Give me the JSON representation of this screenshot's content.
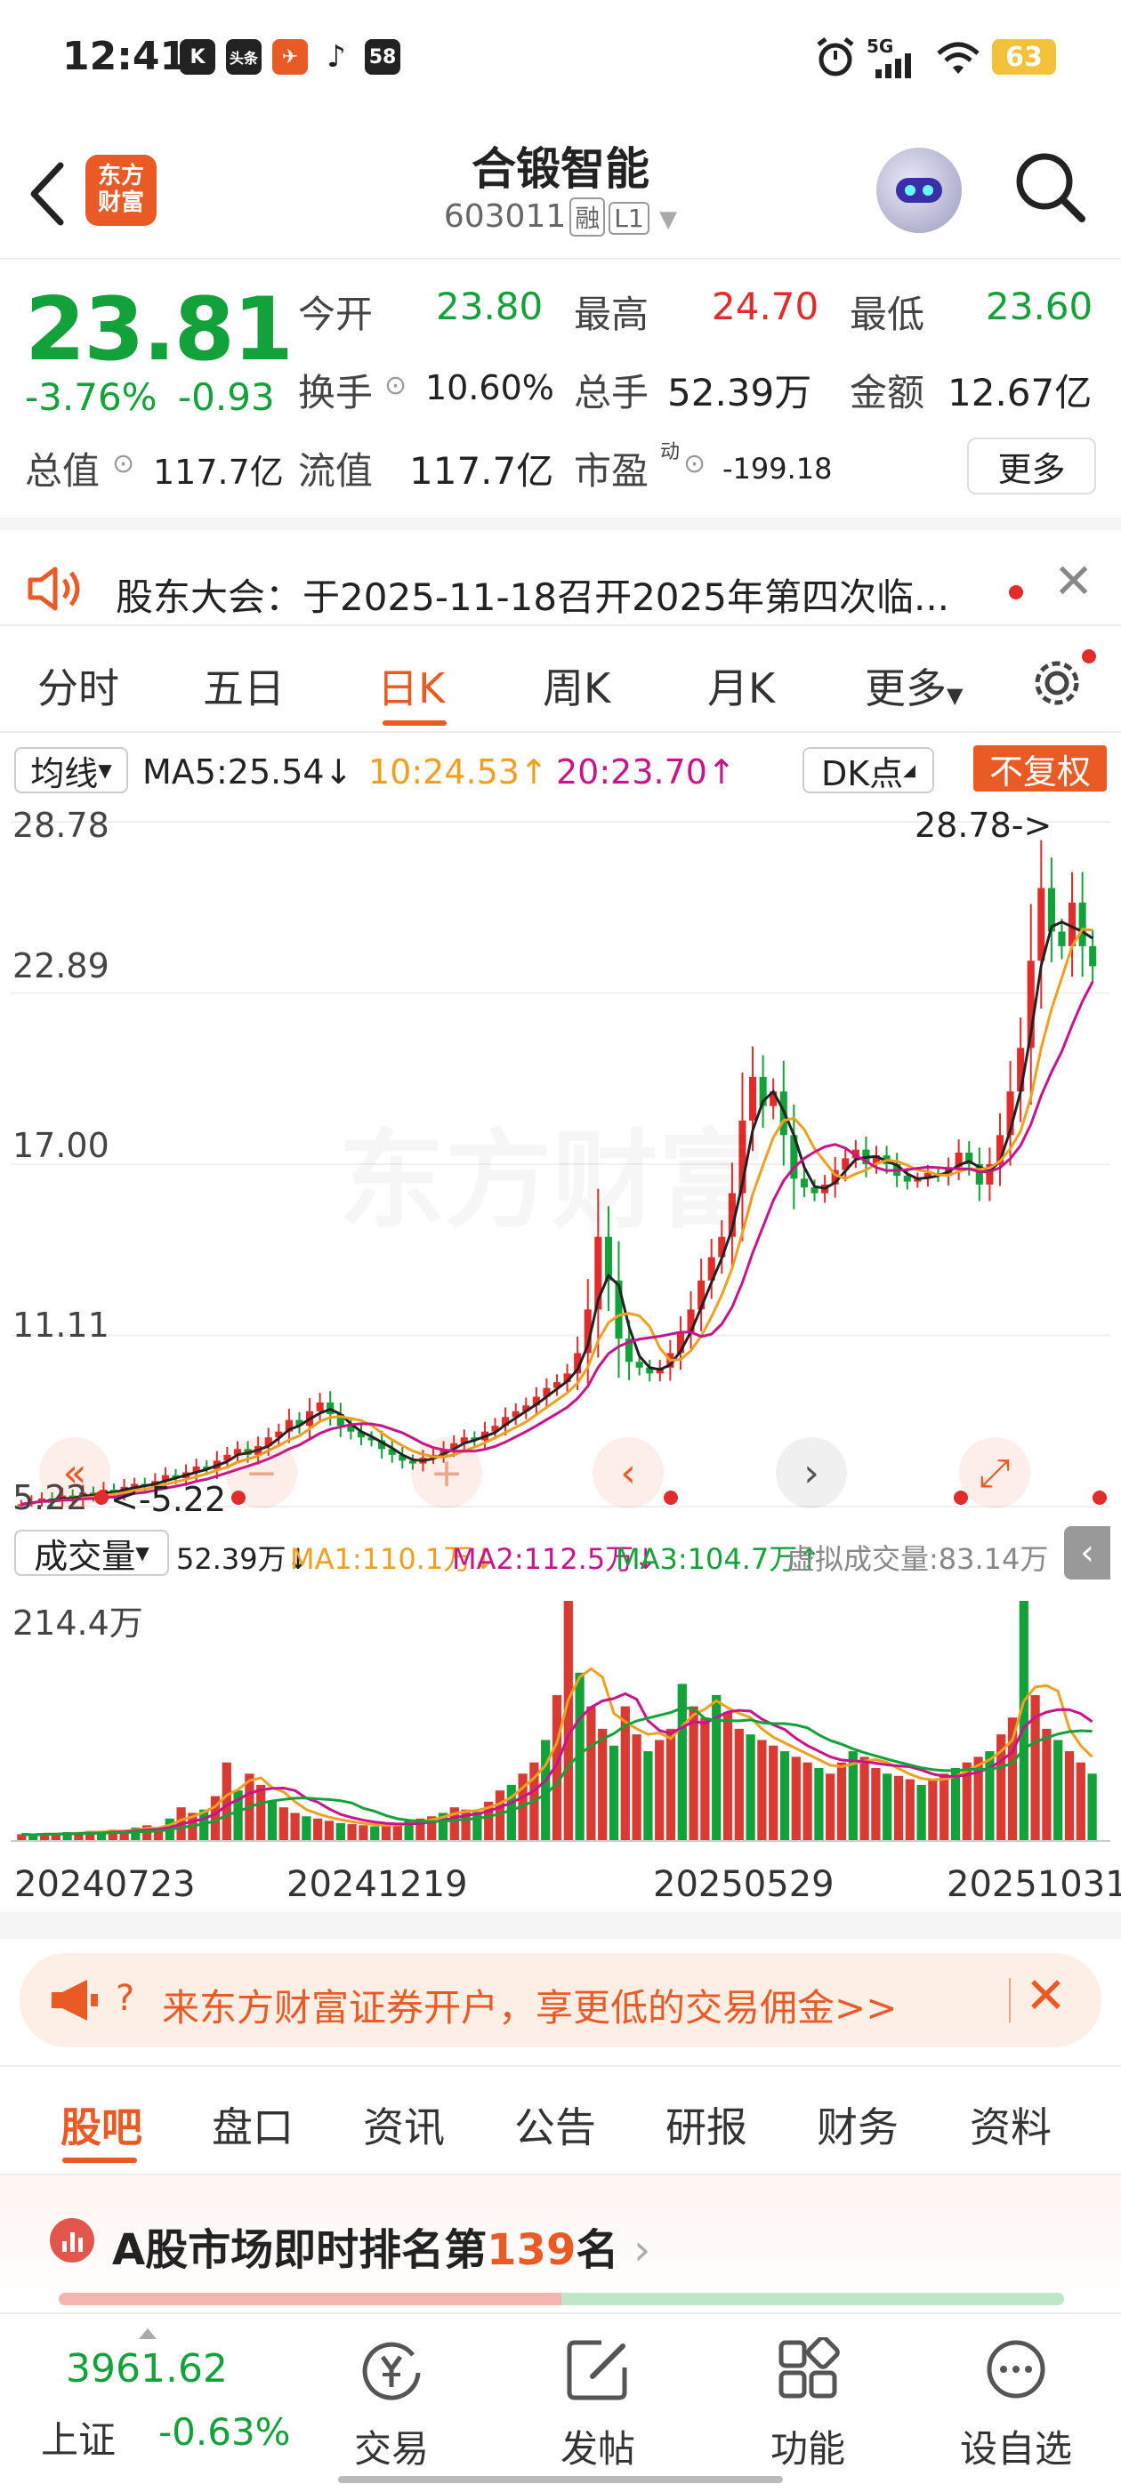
{
  "status_bar": {
    "time": "12:41",
    "app_icons": [
      "K",
      "头条",
      "✈",
      "♪",
      "58"
    ],
    "network": "5G",
    "battery": "63"
  },
  "header": {
    "back_icon": "back-arrow-icon",
    "logo_line1": "东方",
    "logo_line2": "财富",
    "stock_name": "合锻智能",
    "stock_code": "603011",
    "tag_rong": "融",
    "tag_level": "L1"
  },
  "quote": {
    "price": "23.81",
    "change_pct": "-3.76%",
    "change_amt": "-0.93",
    "rows": [
      [
        {
          "label": "今开",
          "value": "23.80",
          "color": "green"
        },
        {
          "label": "最高",
          "value": "24.70",
          "color": "red"
        },
        {
          "label": "最低",
          "value": "23.60",
          "color": "green"
        }
      ],
      [
        {
          "label": "换手",
          "value": "10.60%",
          "color": "dark"
        },
        {
          "label": "总手",
          "value": "52.39万",
          "color": "dark"
        },
        {
          "label": "金额",
          "value": "12.67亿",
          "color": "dark"
        }
      ],
      [
        {
          "label": "总值",
          "value": "117.7亿",
          "color": "dark"
        },
        {
          "label": "流值",
          "value": "117.7亿",
          "color": "dark"
        },
        {
          "label": "市盈",
          "value": "-199.18",
          "color": "dark"
        }
      ]
    ],
    "pe_sup": "动",
    "more_label": "更多"
  },
  "notice": {
    "text": "股东大会：于2025-11-18召开2025年第四次临..."
  },
  "k_tabs": {
    "items": [
      "分时",
      "五日",
      "日K",
      "周K",
      "月K",
      "更多"
    ],
    "active_index": 2
  },
  "indicators": {
    "ma_selector": "均线",
    "ma5": "MA5:25.54",
    "ma10": "10:24.53",
    "ma20": "20:23.70",
    "dk_label": "DK点",
    "fuquan": "不复权",
    "colors": {
      "ma5": "#222222",
      "ma10": "#f0a020",
      "ma20": "#c8148c"
    }
  },
  "chart_data": {
    "type": "candlestick",
    "y_ticks": [
      "28.78",
      "22.89",
      "17.00",
      "11.11",
      "5.22"
    ],
    "ylim": [
      5.22,
      28.78
    ],
    "max_label": "28.78->",
    "min_label": "<-5.22",
    "x_ticks": [
      "20240723",
      "20241219",
      "20250529",
      "20251031"
    ],
    "close": [
      5.3,
      5.4,
      5.5,
      5.4,
      5.6,
      5.5,
      5.7,
      5.6,
      5.8,
      5.7,
      5.9,
      6.0,
      5.9,
      6.1,
      6.3,
      6.2,
      6.4,
      6.6,
      6.5,
      6.8,
      7.0,
      7.2,
      7.0,
      7.3,
      7.6,
      7.8,
      8.2,
      8.0,
      8.5,
      8.8,
      8.4,
      8.0,
      7.8,
      7.6,
      7.5,
      7.2,
      7.0,
      6.8,
      6.7,
      6.9,
      7.0,
      7.2,
      7.4,
      7.6,
      7.5,
      7.8,
      8.0,
      8.3,
      8.5,
      8.7,
      9.0,
      9.3,
      9.5,
      9.8,
      10.5,
      12.0,
      14.5,
      13.0,
      11.0,
      10.2,
      10.0,
      9.8,
      10.0,
      10.5,
      11.2,
      12.0,
      13.0,
      13.8,
      14.5,
      16.0,
      18.5,
      20.0,
      19.0,
      19.5,
      18.0,
      16.5,
      16.2,
      16.0,
      16.3,
      16.8,
      17.2,
      17.5,
      17.0,
      17.3,
      17.0,
      16.6,
      16.4,
      16.5,
      16.7,
      16.6,
      16.9,
      17.4,
      17.0,
      16.3,
      17.0,
      18.0,
      19.5,
      21.0,
      24.0,
      26.5,
      25.0,
      24.5,
      26.0,
      24.5,
      23.81
    ],
    "volume_ylabel": "214.4万",
    "volume": [
      6,
      5,
      7,
      6,
      8,
      7,
      9,
      8,
      10,
      9,
      12,
      14,
      11,
      20,
      30,
      25,
      28,
      40,
      70,
      45,
      60,
      50,
      35,
      30,
      25,
      22,
      20,
      18,
      16,
      15,
      14,
      13,
      14,
      16,
      18,
      20,
      22,
      25,
      30,
      28,
      26,
      35,
      45,
      50,
      60,
      70,
      90,
      130,
      214,
      150,
      120,
      100,
      85,
      120,
      95,
      80,
      90,
      100,
      140,
      120,
      110,
      130,
      115,
      100,
      95,
      90,
      85,
      80,
      75,
      70,
      65,
      60,
      70,
      80,
      75,
      65,
      60,
      58,
      55,
      50,
      55,
      60,
      65,
      70,
      75,
      80,
      95,
      110,
      214,
      130,
      100,
      90,
      80,
      70,
      60
    ],
    "ma_vol1": "MA1:110.1万",
    "ma_vol2": "MA2:112.5万",
    "ma_vol3": "MA3:104.7万",
    "vol_value": "52.39万",
    "virtual_vol": "虚拟成交量:83.14万"
  },
  "volume_selector": "成交量",
  "banner": {
    "text": "来东方财富证券开户，享更低的交易佣金>>"
  },
  "bottom_tabs": {
    "items": [
      "股吧",
      "盘口",
      "资讯",
      "公告",
      "研报",
      "财务",
      "资料"
    ],
    "active_index": 0
  },
  "rank": {
    "prefix": "A股市场即时排名第",
    "number": "139",
    "suffix": "名"
  },
  "bottom_nav": {
    "index_value": "3961.62",
    "index_name": "上证",
    "index_change": "-0.63%",
    "items": [
      {
        "label": "交易",
        "icon": "yen-circle-icon"
      },
      {
        "label": "发帖",
        "icon": "edit-icon"
      },
      {
        "label": "功能",
        "icon": "grid-icon"
      },
      {
        "label": "设自选",
        "icon": "more-circle-icon"
      }
    ]
  }
}
